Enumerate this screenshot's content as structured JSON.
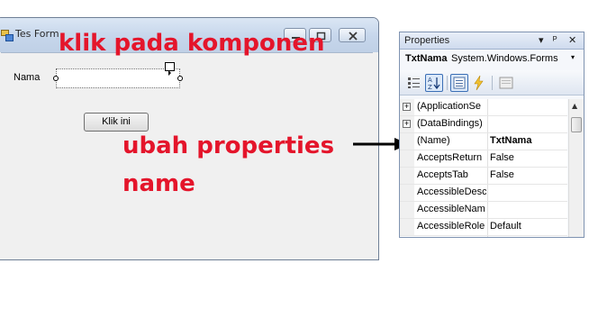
{
  "form": {
    "title": "Tes Form",
    "label_nama": "Nama",
    "button_label": "Klik ini"
  },
  "annotations": {
    "line1": "klik pada komponen",
    "line2": "ubah properties",
    "line3": "name"
  },
  "properties_panel": {
    "title": "Properties",
    "title_glyphs": [
      "▾",
      "ᴾ",
      "✕"
    ],
    "object_name": "TxtNama",
    "object_type": "System.Windows.Forms",
    "object_dropdown": "▾",
    "rows": [
      {
        "name": "(ApplicationSe",
        "value": "",
        "expandable": true
      },
      {
        "name": "(DataBindings)",
        "value": "",
        "expandable": true
      },
      {
        "name": "(Name)",
        "value": "TxtNama",
        "bold": true
      },
      {
        "name": "AcceptsReturn",
        "value": "False"
      },
      {
        "name": "AcceptsTab",
        "value": "False"
      },
      {
        "name": "AccessibleDesc",
        "value": ""
      },
      {
        "name": "AccessibleNam",
        "value": ""
      },
      {
        "name": "AccessibleRole",
        "value": "Default"
      }
    ]
  },
  "colors": {
    "annotation": "#e4152b",
    "panel_border": "#7f93b1"
  },
  "icons": [
    "app-form-icon",
    "minimize-icon",
    "maximize-icon",
    "close-icon",
    "smart-tag-icon",
    "categorized-icon",
    "alphabetical-icon",
    "properties-icon",
    "events-icon",
    "property-pages-icon",
    "arrow-icon"
  ]
}
